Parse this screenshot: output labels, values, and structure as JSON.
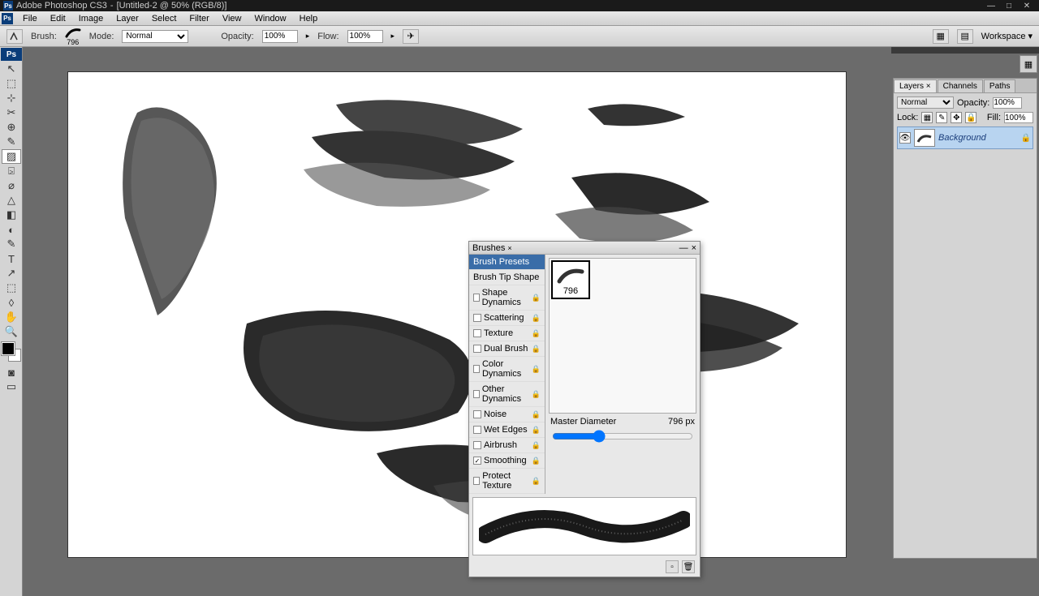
{
  "titlebar": {
    "app": "Adobe Photoshop CS3",
    "doc": "[Untitled-2 @ 50% (RGB/8)]"
  },
  "menu": [
    "File",
    "Edit",
    "Image",
    "Layer",
    "Select",
    "Filter",
    "View",
    "Window",
    "Help"
  ],
  "options": {
    "brush_label": "Brush:",
    "brush_size": "796",
    "mode_label": "Mode:",
    "mode_value": "Normal",
    "opacity_label": "Opacity:",
    "opacity_value": "100%",
    "flow_label": "Flow:",
    "flow_value": "100%",
    "workspace": "Workspace"
  },
  "tools": [
    "↖",
    "⬚",
    "⊹",
    "✂",
    "⊕",
    "✎",
    "▨",
    "⍄",
    "⌀",
    "△",
    "◧",
    "◐",
    "✎",
    "T",
    "↗",
    "⬚",
    "◊",
    "✋",
    "🔍"
  ],
  "right": {
    "tabs": [
      "Layers",
      "Channels",
      "Paths"
    ],
    "blend_mode": "Normal",
    "opacity_label": "Opacity:",
    "opacity_value": "100%",
    "lock_label": "Lock:",
    "fill_label": "Fill:",
    "fill_value": "100%",
    "layer_name": "Background"
  },
  "brushes": {
    "title": "Brushes",
    "sections": [
      {
        "label": "Brush Presets",
        "type": "header",
        "selected": true
      },
      {
        "label": "Brush Tip Shape",
        "type": "header"
      },
      {
        "label": "Shape Dynamics",
        "type": "chk",
        "checked": false
      },
      {
        "label": "Scattering",
        "type": "chk",
        "checked": false
      },
      {
        "label": "Texture",
        "type": "chk",
        "checked": false
      },
      {
        "label": "Dual Brush",
        "type": "chk",
        "checked": false
      },
      {
        "label": "Color Dynamics",
        "type": "chk",
        "checked": false
      },
      {
        "label": "Other Dynamics",
        "type": "chk",
        "checked": false
      },
      {
        "label": "Noise",
        "type": "chk",
        "checked": false
      },
      {
        "label": "Wet Edges",
        "type": "chk",
        "checked": false
      },
      {
        "label": "Airbrush",
        "type": "chk",
        "checked": false
      },
      {
        "label": "Smoothing",
        "type": "chk",
        "checked": true
      },
      {
        "label": "Protect Texture",
        "type": "chk",
        "checked": false
      }
    ],
    "tile_size": "796",
    "diameter_label": "Master Diameter",
    "diameter_value": "796 px"
  }
}
